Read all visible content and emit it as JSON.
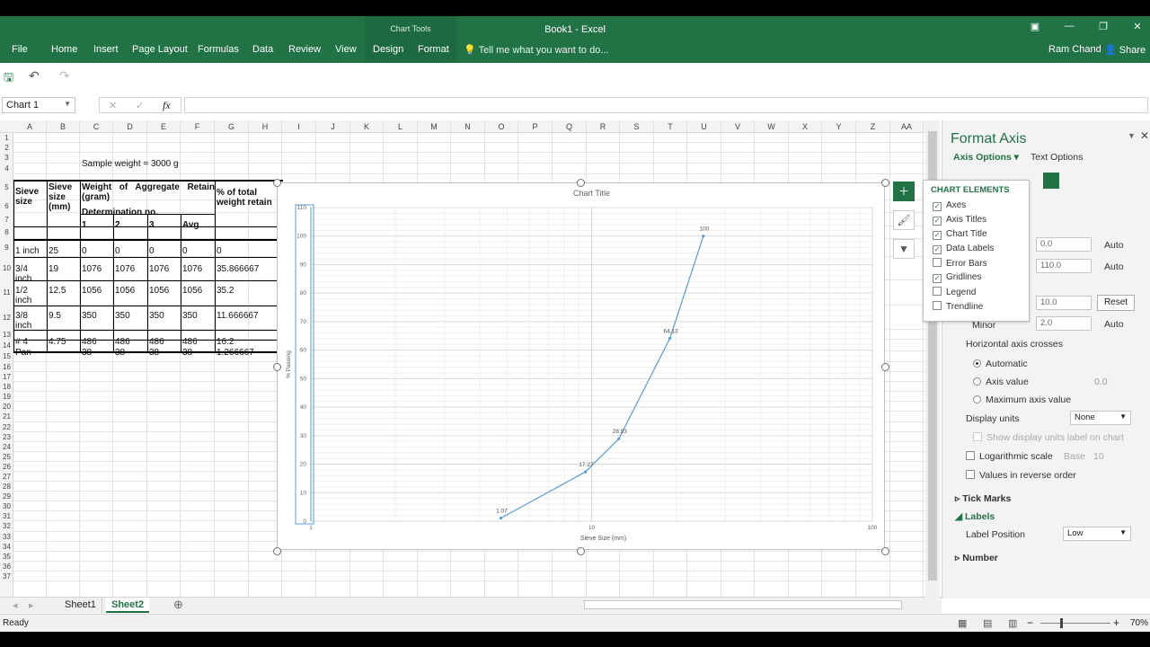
{
  "window": {
    "title": "Book1 - Excel",
    "chart_tools": "Chart Tools",
    "user": "Ram Chand",
    "share": "Share"
  },
  "ribbon": {
    "tabs": [
      "File",
      "Home",
      "Insert",
      "Page Layout",
      "Formulas",
      "Data",
      "Review",
      "View",
      "Design",
      "Format"
    ],
    "tell_me": "Tell me what you want to do..."
  },
  "formula_bar": {
    "name_box": "Chart 1",
    "fx": "fx",
    "value": ""
  },
  "columns": [
    "A",
    "B",
    "C",
    "D",
    "E",
    "F",
    "G",
    "H",
    "I",
    "J",
    "K",
    "L",
    "M",
    "N",
    "O",
    "P",
    "Q",
    "R",
    "S",
    "T",
    "U",
    "V",
    "W",
    "X",
    "Y",
    "Z",
    "AA"
  ],
  "rows": [
    "1",
    "2",
    "3",
    "4",
    "5",
    "6",
    "7",
    "8",
    "9",
    "10",
    "11",
    "12",
    "13",
    "14",
    "15",
    "16",
    "17",
    "18",
    "19",
    "20",
    "21",
    "22",
    "23",
    "24",
    "25",
    "26",
    "27",
    "28",
    "29",
    "30",
    "31",
    "32",
    "33",
    "34",
    "35",
    "36",
    "37"
  ],
  "sheet": {
    "sample_weight": "Sample weight = 3000 g",
    "h_sieve_size": "Sieve size",
    "h_sieve_size_mm": "Sieve size (mm)",
    "h_weight": "Weight of Aggregate Retain (gram)",
    "h_determination": "Determination no.",
    "h_pct": "% of total weight retain",
    "sub_headers": [
      "1",
      "2",
      "3",
      "Avg"
    ],
    "data_rows": [
      {
        "a": "1 inch",
        "b": "25",
        "c": "0",
        "d": "0",
        "e": "0",
        "f": "0",
        "g": "0"
      },
      {
        "a": "3/4 inch",
        "b": "19",
        "c": "1076",
        "d": "1076",
        "e": "1076",
        "f": "1076",
        "g": "35.866667"
      },
      {
        "a": "1/2 inch",
        "b": "12.5",
        "c": "1056",
        "d": "1056",
        "e": "1056",
        "f": "1056",
        "g": "35.2"
      },
      {
        "a": "3/8 inch",
        "b": "9.5",
        "c": "350",
        "d": "350",
        "e": "350",
        "f": "350",
        "g": "11.666667"
      },
      {
        "a": "# 4",
        "b": "4.75",
        "c": "486",
        "d": "486",
        "e": "486",
        "f": "486",
        "g": "16.2"
      },
      {
        "a": "Pan",
        "b": "",
        "c": "38",
        "d": "38",
        "e": "38",
        "f": "38",
        "g": "1.266667"
      }
    ]
  },
  "chart_data": {
    "type": "scatter",
    "title": "Chart Title",
    "xlabel": "Sieve Size (mm)",
    "ylabel": "% Passing",
    "x_scale": "log",
    "xlim": [
      1,
      100
    ],
    "ylim": [
      0,
      110
    ],
    "x_ticks": [
      "1",
      "10",
      "100"
    ],
    "y_ticks": [
      "0",
      "10",
      "20",
      "30",
      "40",
      "50",
      "60",
      "70",
      "80",
      "90",
      "100",
      "110"
    ],
    "grid": true,
    "legend": "none",
    "series": [
      {
        "x": [
          4.75,
          9.5,
          12.5,
          19,
          25
        ],
        "y": [
          1.07,
          17.27,
          28.93,
          64.13,
          100
        ],
        "labels": [
          "1.07",
          "17.27",
          "28.93",
          "64.13",
          "100"
        ]
      }
    ],
    "line_color": "#5b9bd5"
  },
  "chart_elements": {
    "title": "CHART ELEMENTS",
    "items": [
      {
        "label": "Axes",
        "checked": true
      },
      {
        "label": "Axis Titles",
        "checked": true
      },
      {
        "label": "Chart Title",
        "checked": true
      },
      {
        "label": "Data Labels",
        "checked": true
      },
      {
        "label": "Error Bars",
        "checked": false
      },
      {
        "label": "Gridlines",
        "checked": true
      },
      {
        "label": "Legend",
        "checked": false
      },
      {
        "label": "Trendline",
        "checked": false
      }
    ]
  },
  "format_pane": {
    "title": "Format Axis",
    "tab_axis": "Axis Options",
    "tab_text": "Text Options",
    "min_value": "0.0",
    "min_auto": "Auto",
    "max_value": "110.0",
    "max_auto": "Auto",
    "major_value": "10.0",
    "major_btn": "Reset",
    "minor_label": "Minor",
    "minor_value": "2.0",
    "minor_auto": "Auto",
    "h_axis_crosses": "Horizontal axis crosses",
    "opt_automatic": "Automatic",
    "opt_axis_value": "Axis value",
    "axis_value": "0.0",
    "opt_max": "Maximum axis value",
    "display_units_label": "Display units",
    "display_units": "None",
    "show_units_label": "Show display units label on chart",
    "log_scale": "Logarithmic scale",
    "base_label": "Base",
    "base_value": "10",
    "reverse": "Values in reverse order",
    "tick_marks": "Tick Marks",
    "labels": "Labels",
    "label_position_label": "Label Position",
    "label_position": "Low",
    "number": "Number"
  },
  "sheet_tabs": [
    "Sheet1",
    "Sheet2"
  ],
  "status": {
    "ready": "Ready",
    "zoom": "70%"
  },
  "colors": {
    "accent": "#217346"
  }
}
